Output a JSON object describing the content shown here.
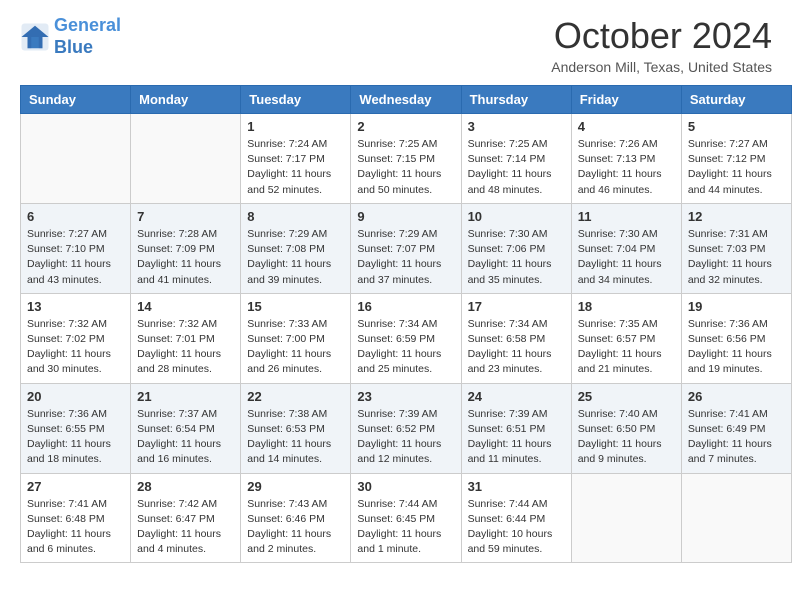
{
  "header": {
    "logo_line1": "General",
    "logo_line2": "Blue",
    "month_title": "October 2024",
    "location": "Anderson Mill, Texas, United States"
  },
  "days_of_week": [
    "Sunday",
    "Monday",
    "Tuesday",
    "Wednesday",
    "Thursday",
    "Friday",
    "Saturday"
  ],
  "weeks": [
    [
      {
        "day": "",
        "info": ""
      },
      {
        "day": "",
        "info": ""
      },
      {
        "day": "1",
        "info": "Sunrise: 7:24 AM\nSunset: 7:17 PM\nDaylight: 11 hours and 52 minutes."
      },
      {
        "day": "2",
        "info": "Sunrise: 7:25 AM\nSunset: 7:15 PM\nDaylight: 11 hours and 50 minutes."
      },
      {
        "day": "3",
        "info": "Sunrise: 7:25 AM\nSunset: 7:14 PM\nDaylight: 11 hours and 48 minutes."
      },
      {
        "day": "4",
        "info": "Sunrise: 7:26 AM\nSunset: 7:13 PM\nDaylight: 11 hours and 46 minutes."
      },
      {
        "day": "5",
        "info": "Sunrise: 7:27 AM\nSunset: 7:12 PM\nDaylight: 11 hours and 44 minutes."
      }
    ],
    [
      {
        "day": "6",
        "info": "Sunrise: 7:27 AM\nSunset: 7:10 PM\nDaylight: 11 hours and 43 minutes."
      },
      {
        "day": "7",
        "info": "Sunrise: 7:28 AM\nSunset: 7:09 PM\nDaylight: 11 hours and 41 minutes."
      },
      {
        "day": "8",
        "info": "Sunrise: 7:29 AM\nSunset: 7:08 PM\nDaylight: 11 hours and 39 minutes."
      },
      {
        "day": "9",
        "info": "Sunrise: 7:29 AM\nSunset: 7:07 PM\nDaylight: 11 hours and 37 minutes."
      },
      {
        "day": "10",
        "info": "Sunrise: 7:30 AM\nSunset: 7:06 PM\nDaylight: 11 hours and 35 minutes."
      },
      {
        "day": "11",
        "info": "Sunrise: 7:30 AM\nSunset: 7:04 PM\nDaylight: 11 hours and 34 minutes."
      },
      {
        "day": "12",
        "info": "Sunrise: 7:31 AM\nSunset: 7:03 PM\nDaylight: 11 hours and 32 minutes."
      }
    ],
    [
      {
        "day": "13",
        "info": "Sunrise: 7:32 AM\nSunset: 7:02 PM\nDaylight: 11 hours and 30 minutes."
      },
      {
        "day": "14",
        "info": "Sunrise: 7:32 AM\nSunset: 7:01 PM\nDaylight: 11 hours and 28 minutes."
      },
      {
        "day": "15",
        "info": "Sunrise: 7:33 AM\nSunset: 7:00 PM\nDaylight: 11 hours and 26 minutes."
      },
      {
        "day": "16",
        "info": "Sunrise: 7:34 AM\nSunset: 6:59 PM\nDaylight: 11 hours and 25 minutes."
      },
      {
        "day": "17",
        "info": "Sunrise: 7:34 AM\nSunset: 6:58 PM\nDaylight: 11 hours and 23 minutes."
      },
      {
        "day": "18",
        "info": "Sunrise: 7:35 AM\nSunset: 6:57 PM\nDaylight: 11 hours and 21 minutes."
      },
      {
        "day": "19",
        "info": "Sunrise: 7:36 AM\nSunset: 6:56 PM\nDaylight: 11 hours and 19 minutes."
      }
    ],
    [
      {
        "day": "20",
        "info": "Sunrise: 7:36 AM\nSunset: 6:55 PM\nDaylight: 11 hours and 18 minutes."
      },
      {
        "day": "21",
        "info": "Sunrise: 7:37 AM\nSunset: 6:54 PM\nDaylight: 11 hours and 16 minutes."
      },
      {
        "day": "22",
        "info": "Sunrise: 7:38 AM\nSunset: 6:53 PM\nDaylight: 11 hours and 14 minutes."
      },
      {
        "day": "23",
        "info": "Sunrise: 7:39 AM\nSunset: 6:52 PM\nDaylight: 11 hours and 12 minutes."
      },
      {
        "day": "24",
        "info": "Sunrise: 7:39 AM\nSunset: 6:51 PM\nDaylight: 11 hours and 11 minutes."
      },
      {
        "day": "25",
        "info": "Sunrise: 7:40 AM\nSunset: 6:50 PM\nDaylight: 11 hours and 9 minutes."
      },
      {
        "day": "26",
        "info": "Sunrise: 7:41 AM\nSunset: 6:49 PM\nDaylight: 11 hours and 7 minutes."
      }
    ],
    [
      {
        "day": "27",
        "info": "Sunrise: 7:41 AM\nSunset: 6:48 PM\nDaylight: 11 hours and 6 minutes."
      },
      {
        "day": "28",
        "info": "Sunrise: 7:42 AM\nSunset: 6:47 PM\nDaylight: 11 hours and 4 minutes."
      },
      {
        "day": "29",
        "info": "Sunrise: 7:43 AM\nSunset: 6:46 PM\nDaylight: 11 hours and 2 minutes."
      },
      {
        "day": "30",
        "info": "Sunrise: 7:44 AM\nSunset: 6:45 PM\nDaylight: 11 hours and 1 minute."
      },
      {
        "day": "31",
        "info": "Sunrise: 7:44 AM\nSunset: 6:44 PM\nDaylight: 10 hours and 59 minutes."
      },
      {
        "day": "",
        "info": ""
      },
      {
        "day": "",
        "info": ""
      }
    ]
  ]
}
